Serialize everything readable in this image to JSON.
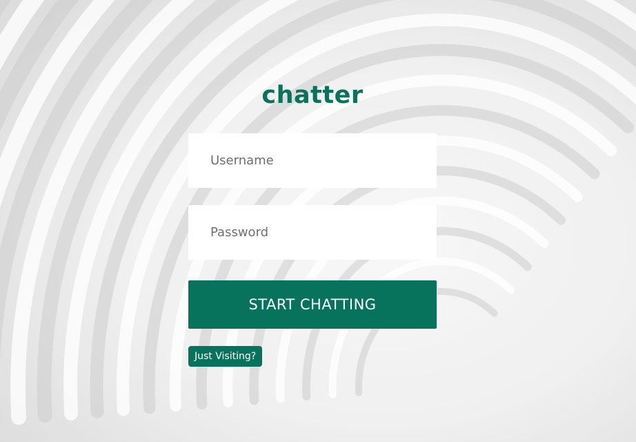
{
  "app": {
    "logo_text": "chatter"
  },
  "login_form": {
    "username_placeholder": "Username",
    "password_placeholder": "Password",
    "submit_label": "START CHATTING",
    "guest_label": "Just Visiting?"
  },
  "colors": {
    "accent": "#07735c",
    "field_background": "#ffffff",
    "background": "#eeeeee"
  }
}
